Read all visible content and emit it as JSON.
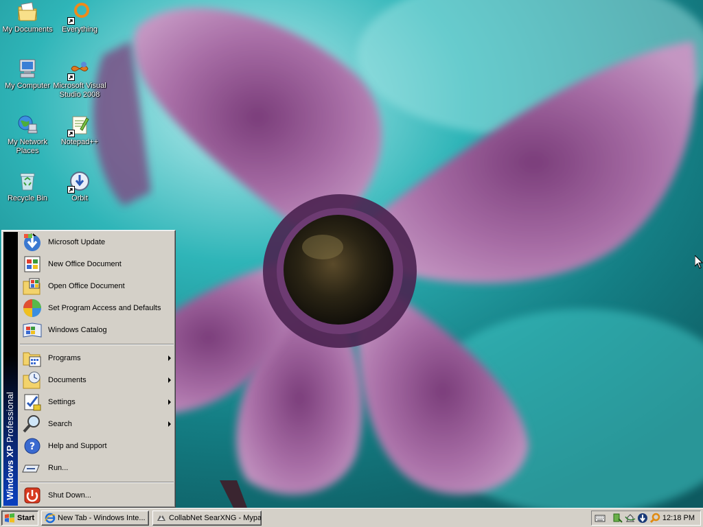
{
  "desktop": {
    "icons": [
      {
        "label": "My Documents",
        "icon": "my-documents-icon",
        "shortcut": false
      },
      {
        "label": "Everything",
        "icon": "everything-icon",
        "shortcut": true
      },
      {
        "label": "My Computer",
        "icon": "my-computer-icon",
        "shortcut": false
      },
      {
        "label": "Microsoft Visual Studio 2008",
        "icon": "visual-studio-icon",
        "shortcut": true
      },
      {
        "label": "My Network Places",
        "icon": "network-places-icon",
        "shortcut": false
      },
      {
        "label": "Notepad++",
        "icon": "notepad-plus-plus-icon",
        "shortcut": true
      },
      {
        "label": "Recycle Bin",
        "icon": "recycle-bin-icon",
        "shortcut": false
      },
      {
        "label": "Orbit",
        "icon": "orbit-icon",
        "shortcut": true
      }
    ]
  },
  "start_menu": {
    "banner": {
      "bold": "Windows XP",
      "rest": " Professional"
    },
    "top_items": [
      {
        "label": "Microsoft Update",
        "icon": "windows-update-icon"
      },
      {
        "label": "New Office Document",
        "icon": "new-office-document-icon"
      },
      {
        "label": "Open Office Document",
        "icon": "open-office-document-icon"
      },
      {
        "label": "Set Program Access and Defaults",
        "icon": "program-access-icon"
      },
      {
        "label": "Windows Catalog",
        "icon": "windows-catalog-icon"
      }
    ],
    "main_items": [
      {
        "label": "Programs",
        "icon": "programs-icon",
        "submenu": true
      },
      {
        "label": "Documents",
        "icon": "documents-icon",
        "submenu": true
      },
      {
        "label": "Settings",
        "icon": "settings-icon",
        "submenu": true
      },
      {
        "label": "Search",
        "icon": "search-icon",
        "submenu": true
      },
      {
        "label": "Help and Support",
        "icon": "help-icon",
        "submenu": false
      },
      {
        "label": "Run...",
        "icon": "run-icon",
        "submenu": false
      }
    ],
    "shutdown": {
      "label": "Shut Down...",
      "icon": "shutdown-icon"
    }
  },
  "taskbar": {
    "start_label": "Start",
    "tasks": [
      {
        "label": "New Tab - Windows Inte...",
        "icon": "internet-explorer-icon"
      },
      {
        "label": "CollabNet SearXNG - Mypal",
        "icon": "mypal-browser-icon"
      }
    ],
    "tray_icons": [
      "keyboard-icon",
      "safely-remove-icon",
      "network-icon",
      "orbit-tray-icon",
      "search-tray-icon"
    ],
    "clock": "12:18 PM"
  },
  "colors": {
    "chrome": "#d4d0c8",
    "banner_blue": "#0a246a",
    "wallpaper_teal": "#1c8f93",
    "flower_pink": "#b57bb0"
  }
}
